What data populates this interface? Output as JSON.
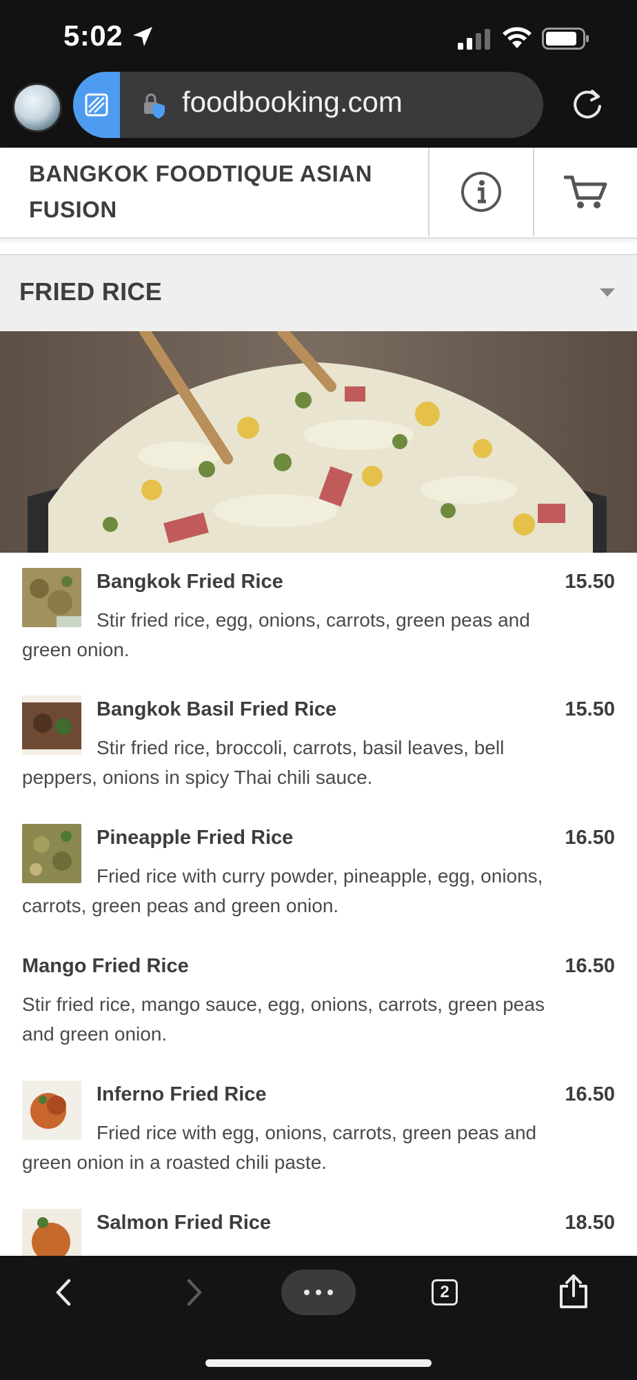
{
  "status_bar": {
    "time": "5:02"
  },
  "browser": {
    "url": "foodbooking.com"
  },
  "header": {
    "restaurant_name": "BANGKOK FOODTIQUE ASIAN FUSION"
  },
  "category": {
    "title": "FRIED RICE"
  },
  "menu": {
    "items": [
      {
        "name": "Bangkok Fried Rice",
        "price": "15.50",
        "description": "Stir fried rice, egg, onions, carrots, green peas and green onion."
      },
      {
        "name": "Bangkok Basil Fried Rice",
        "price": "15.50",
        "description": "Stir fried rice, broccoli, carrots, basil leaves, bell peppers, onions in spicy Thai chili sauce."
      },
      {
        "name": "Pineapple Fried Rice",
        "price": "16.50",
        "description": "Fried rice with curry powder, pineapple, egg, onions, carrots, green peas and green onion."
      },
      {
        "name": "Mango Fried Rice",
        "price": "16.50",
        "description": "Stir fried rice, mango sauce, egg, onions, carrots, green peas and green onion."
      },
      {
        "name": "Inferno Fried Rice",
        "price": "16.50",
        "description": "Fried rice with egg, onions, carrots, green peas and green onion in a roasted chili paste."
      },
      {
        "name": "Salmon Fried Rice",
        "price": "18.50",
        "description": ""
      }
    ]
  },
  "toolbar": {
    "tab_count": "2"
  }
}
